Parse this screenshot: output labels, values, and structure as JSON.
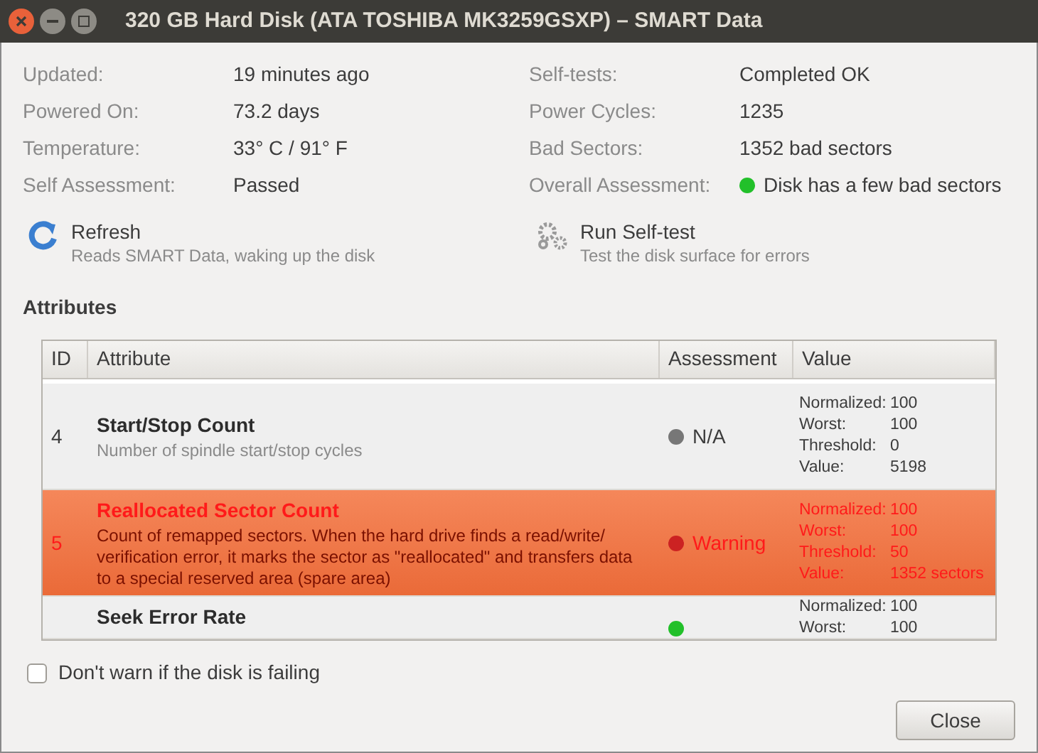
{
  "window": {
    "title": "320 GB Hard Disk (ATA TOSHIBA MK3259GSXP) – SMART Data"
  },
  "info_left": [
    {
      "label": "Updated:",
      "value": "19 minutes ago"
    },
    {
      "label": "Powered On:",
      "value": "73.2 days"
    },
    {
      "label": "Temperature:",
      "value": "33° C / 91° F"
    },
    {
      "label": "Self Assessment:",
      "value": "Passed"
    }
  ],
  "info_right": [
    {
      "label": "Self-tests:",
      "value": "Completed OK"
    },
    {
      "label": "Power Cycles:",
      "value": "1235"
    },
    {
      "label": "Bad Sectors:",
      "value": "1352 bad sectors"
    },
    {
      "label": "Overall Assessment:",
      "value": "Disk has a few bad sectors",
      "color": "#22c02a"
    }
  ],
  "actions": [
    {
      "kind": "refresh",
      "title": "Refresh",
      "description": "Reads SMART Data, waking up the disk"
    },
    {
      "kind": "selftest",
      "title": "Run Self-test",
      "description": "Test the disk surface for errors"
    }
  ],
  "attributes": {
    "heading": "Attributes",
    "columns": [
      "ID",
      "Attribute",
      "Assessment",
      "Value"
    ],
    "rows": [
      {
        "id": "4",
        "name": "Start/Stop Count",
        "description": "Number of spindle start/stop cycles",
        "assessment": "N/A",
        "color": "#777777",
        "selected": false,
        "values": [
          {
            "label": "Normalized:",
            "value": "100"
          },
          {
            "label": "Worst:",
            "value": "100"
          },
          {
            "label": "Threshold:",
            "value": "0"
          },
          {
            "label": "Value:",
            "value": "5198"
          }
        ]
      },
      {
        "id": "5",
        "name": "Reallocated Sector Count",
        "description": "Count of remapped sectors. When the hard drive finds a read/write/ verification error, it marks the sector as \"reallocated\" and transfers data to a special reserved area (spare area)",
        "assessment": "Warning",
        "color": "#cc2222",
        "selected": true,
        "values": [
          {
            "label": "Normalized:",
            "value": "100"
          },
          {
            "label": "Worst:",
            "value": "100"
          },
          {
            "label": "Threshold:",
            "value": "50"
          },
          {
            "label": "Value:",
            "value": "1352 sectors"
          }
        ]
      },
      {
        "name": "Seek Error Rate",
        "color": "#22c02a",
        "selected": false,
        "values": [
          {
            "label": "Normalized:",
            "value": "100"
          },
          {
            "label": "Worst:",
            "value": "100"
          }
        ]
      }
    ]
  },
  "dont_warn": {
    "label": "Don't warn if the disk is failing",
    "checked": false
  },
  "buttons": [
    "Close"
  ]
}
